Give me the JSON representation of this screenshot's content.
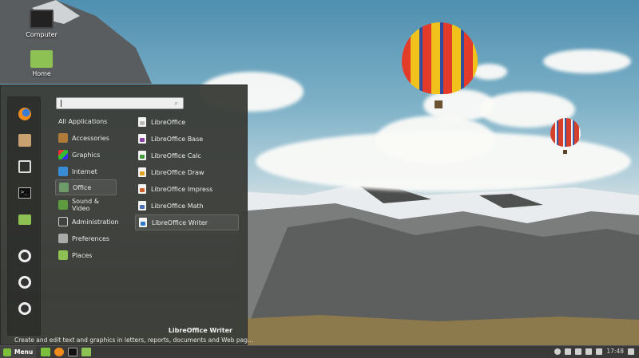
{
  "desktop": {
    "icons": [
      {
        "label": "Computer",
        "icon": "computer-icon"
      },
      {
        "label": "Home",
        "icon": "home-folder-icon"
      }
    ]
  },
  "menu": {
    "search": {
      "placeholder": ""
    },
    "favorites": [
      "firefox-icon",
      "software-manager-icon",
      "system-settings-icon",
      "terminal-icon",
      "files-icon",
      "lock-screen-icon",
      "logout-icon",
      "shutdown-icon"
    ],
    "categories": [
      {
        "label": "All Applications",
        "selected": false
      },
      {
        "label": "Accessories",
        "icon": "accessories-icon",
        "selected": false
      },
      {
        "label": "Graphics",
        "icon": "graphics-icon",
        "selected": false
      },
      {
        "label": "Internet",
        "icon": "internet-icon",
        "selected": false
      },
      {
        "label": "Office",
        "icon": "office-icon",
        "selected": true
      },
      {
        "label": "Sound & Video",
        "icon": "sound-video-icon",
        "selected": false
      },
      {
        "label": "Administration",
        "icon": "administration-icon",
        "selected": false
      },
      {
        "label": "Preferences",
        "icon": "preferences-icon",
        "selected": false
      },
      {
        "label": "Places",
        "icon": "places-folder-icon",
        "selected": false
      }
    ],
    "apps": [
      {
        "label": "LibreOffice",
        "color": "#bbbbbb",
        "selected": false
      },
      {
        "label": "LibreOffice Base",
        "color": "#8e3fa8",
        "selected": false
      },
      {
        "label": "LibreOffice Calc",
        "color": "#3e9b3a",
        "selected": false
      },
      {
        "label": "LibreOffice Draw",
        "color": "#e0a020",
        "selected": false
      },
      {
        "label": "LibreOffice Impress",
        "color": "#d0602a",
        "selected": false
      },
      {
        "label": "LibreOffice Math",
        "color": "#4a6fb5",
        "selected": false
      },
      {
        "label": "LibreOffice Writer",
        "color": "#2f78c8",
        "selected": true
      }
    ],
    "description": {
      "title": "LibreOffice Writer",
      "text": "Create and edit text and graphics in letters, reports, documents and Web pag..."
    }
  },
  "taskbar": {
    "menu_label": "Menu",
    "clock": "17:48"
  }
}
